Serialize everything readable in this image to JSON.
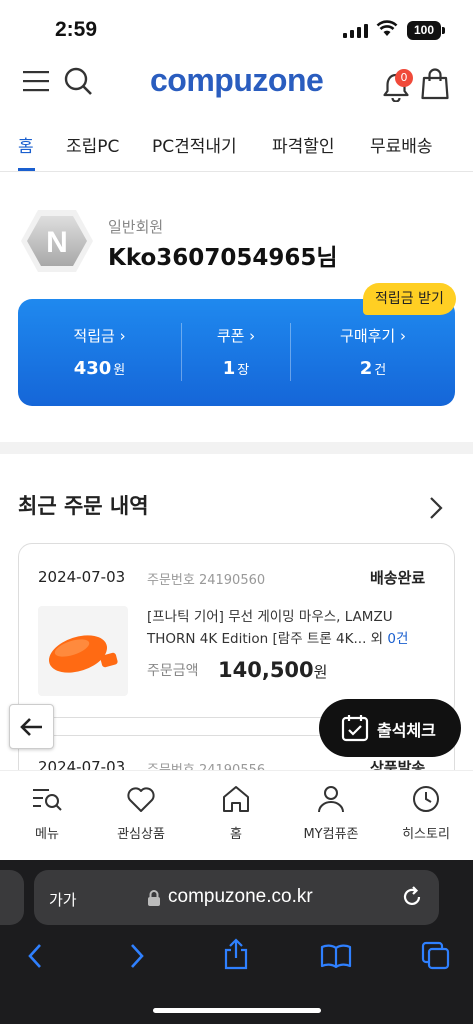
{
  "status_bar": {
    "time": "2:59",
    "battery": "100"
  },
  "header": {
    "logo": "compuzone",
    "cart_badge": "0"
  },
  "tabs": [
    {
      "label": "홈",
      "active": true
    },
    {
      "label": "조립PC"
    },
    {
      "label": "PC견적내기"
    },
    {
      "label": "파격할인"
    },
    {
      "label": "무료배송"
    }
  ],
  "profile": {
    "avatar_letter": "N",
    "member_type": "일반회원",
    "name": "Kko3607054965님"
  },
  "points_card": {
    "badge": "적립금 받기",
    "items": [
      {
        "label": "적립금 ›",
        "value": "430",
        "unit": "원"
      },
      {
        "label": "쿠폰 ›",
        "value": "1",
        "unit": "장"
      },
      {
        "label": "구매후기 ›",
        "value": "2",
        "unit": "건"
      }
    ]
  },
  "recent_orders": {
    "title": "최근 주문 내역",
    "orders": [
      {
        "date": "2024-07-03",
        "order_no": "주문번호 24190560",
        "status": "배송완료",
        "title": "[프나틱 기어] 무선 게이밍 마우스, LAMZU THORN 4K Edition [람주 트론 4K... 외",
        "extra": "0건",
        "price_label": "주문금액",
        "price": "140,500",
        "price_unit": "원"
      },
      {
        "date": "2024-07-03",
        "order_no": "주문번호 24190556",
        "status": "상품발송"
      }
    ]
  },
  "floating": {
    "attend_label": "출석체크"
  },
  "bottom_nav": [
    {
      "label": "메뉴",
      "icon": "menu-search-icon"
    },
    {
      "label": "관심상품",
      "icon": "heart-icon"
    },
    {
      "label": "홈",
      "icon": "home-icon"
    },
    {
      "label": "MY컴퓨존",
      "icon": "person-icon"
    },
    {
      "label": "히스토리",
      "icon": "clock-icon"
    }
  ],
  "safari": {
    "aa": "가가",
    "url": "compuzone.co.kr"
  },
  "colors": {
    "brand": "#2a5dbf",
    "accent_blue": "#1a5fcf",
    "badge_yellow": "#ffcf23",
    "badge_red": "#f04a3a"
  }
}
